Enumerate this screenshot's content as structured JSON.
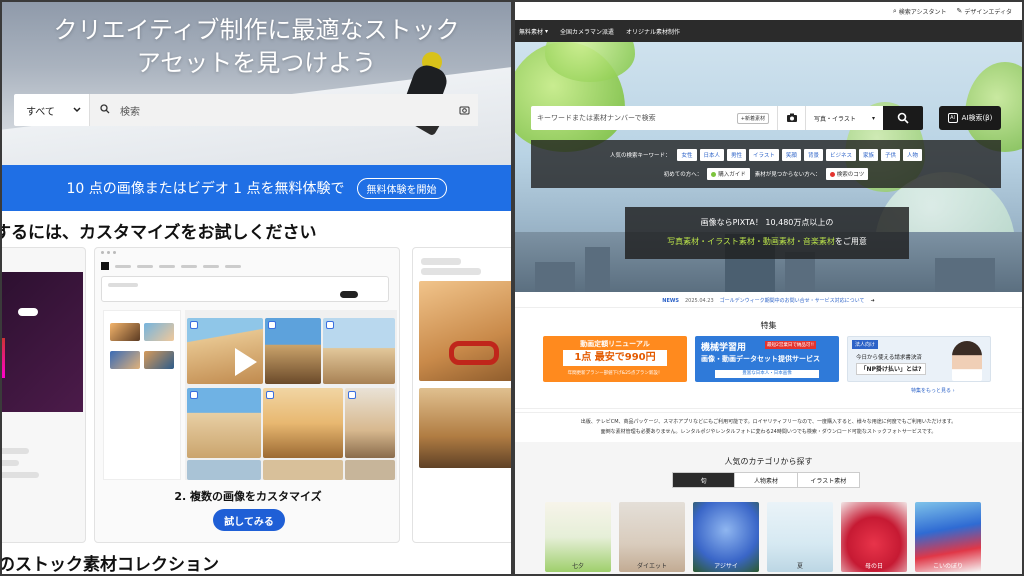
{
  "left": {
    "hero": {
      "line1": "クリエイティブ制作に最適なストック",
      "line2": "アセットを見つけよう"
    },
    "search": {
      "scope": "すべて",
      "placeholder": "検索"
    },
    "promo": {
      "text": "10 点の画像またはビデオ 1 点を無料体験で",
      "button": "無料体験を開始"
    },
    "customize_title": "するには、カスタマイズをお試しください",
    "card": {
      "caption": "2. 複数の画像をカスタマイズ",
      "button": "試してみる"
    },
    "collection_title": "のストック素材コレクション"
  },
  "right": {
    "util": {
      "assistant": "検索アシスタント",
      "editor": "デザインエディタ"
    },
    "nav": {
      "items": [
        "無料素材",
        "全国カメラマン派遣",
        "オリジナル素材制作"
      ]
    },
    "search": {
      "placeholder": "キーワードまたは素材ナンバーで検索",
      "new_label": "+新着素材",
      "type": "写真・イラスト",
      "ai_button": "AI検索(β)"
    },
    "keywords": {
      "label": "人気の検索キーワード：",
      "chips": [
        "女性",
        "日本人",
        "男性",
        "イラスト",
        "笑顔",
        "背景",
        "ビジネス",
        "家族",
        "子供",
        "人物"
      ],
      "first_label": "初めての方へ：",
      "guide": "購入ガイド",
      "notfound_label": "素材が見つからない方へ：",
      "tips": "検索のコツ"
    },
    "pixta": {
      "line1": "画像ならPIXTA！ 10,480万点以上の",
      "line2_green": "写真素材・イラスト素材・動画素材・音楽素材",
      "line2_rest": "をご用意"
    },
    "news": {
      "tag": "NEWS",
      "date": "2025.04.23",
      "text": "ゴールデンウィーク期間中のお問い合せ・サービス対応について"
    },
    "feature_title": "特集",
    "banners": {
      "b1_title": "動画定額リニューアル",
      "b1_main": "1点 最安で990円",
      "b1_sub": "年間更新プランー部値下げ&25点プラン新設！",
      "b2_title": "機械学習用",
      "b2_badge": "最短2営業日で納品可!!",
      "b2_main": "画像・動画データセット提供サービス",
      "b2_sub": "豊富な日本人・日本画像",
      "b3_tag": "法人向け",
      "b3_text": "今日から使える請求書決済",
      "b3_main": "「NP掛け払い」とは?"
    },
    "feature_more": "特集をもっと見る ›",
    "description": {
      "line1": "出版、テレビCM、商品パッケージ、スマホアプリなどにもご利用可能です。ロイヤリティフリーなので、一度購入すると、様々な用途に何度でもご利用いただけます。",
      "line2": "面倒な素材管理も必要ありません。レンタルポジやレンタルフォトに変わる24時間いつでも検索・ダウンロード可能なストックフォトサービスです。"
    },
    "categories": {
      "title": "人気のカテゴリから探す",
      "tabs": [
        "旬",
        "人物素材",
        "イラスト素材"
      ],
      "active_tab": "旬",
      "items": [
        "七夕",
        "ダイエット",
        "アジサイ",
        "夏",
        "母の日",
        "こいのぼり"
      ]
    }
  }
}
